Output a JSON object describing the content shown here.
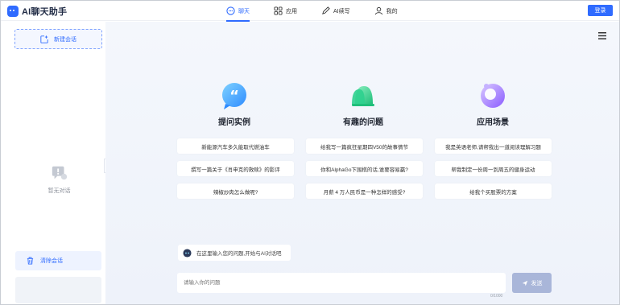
{
  "app": {
    "title": "AI聊天助手"
  },
  "nav": {
    "items": [
      {
        "label": "聊天",
        "icon": "chat-icon",
        "active": true
      },
      {
        "label": "应用",
        "icon": "apps-icon",
        "active": false
      },
      {
        "label": "AI续写",
        "icon": "pen-icon",
        "active": false
      },
      {
        "label": "我的",
        "icon": "user-icon",
        "active": false
      }
    ],
    "login_label": "登录"
  },
  "sidebar": {
    "new_chat_label": "新建会话",
    "empty_text": "暂无对话",
    "clear_label": "清除会话"
  },
  "main": {
    "columns": [
      {
        "title": "提问实例",
        "icon": "quote-bubble-icon",
        "items": [
          "新能源汽车多久能取代燃油车",
          "撰写一篇关于《肖申克的救赎》的影评",
          "辣椒炒肉怎么做呢?"
        ]
      },
      {
        "title": "有趣的问题",
        "icon": "bell-icon",
        "items": [
          "给我写一篇疯狂星期四V50的故事情节",
          "你和AlphaGo下围棋的话,谁要容易赢?",
          "月薪 4 万人民币是一种怎样的感受?"
        ]
      },
      {
        "title": "应用场景",
        "icon": "scene-disc-icon",
        "items": [
          "我是英语老师,请帮我出一道阅读理解习题",
          "帮我制定一份周一到周五的健身运动",
          "给我个买股票的方案"
        ]
      }
    ],
    "hint_text": "在这里输入您的问题,开始与AI对话吧",
    "input_placeholder": "请输入你的问题",
    "counter": "0/1000",
    "send_label": "发送"
  },
  "colors": {
    "accent": "#2f6bff",
    "send_disabled": "#a9b6d9"
  }
}
